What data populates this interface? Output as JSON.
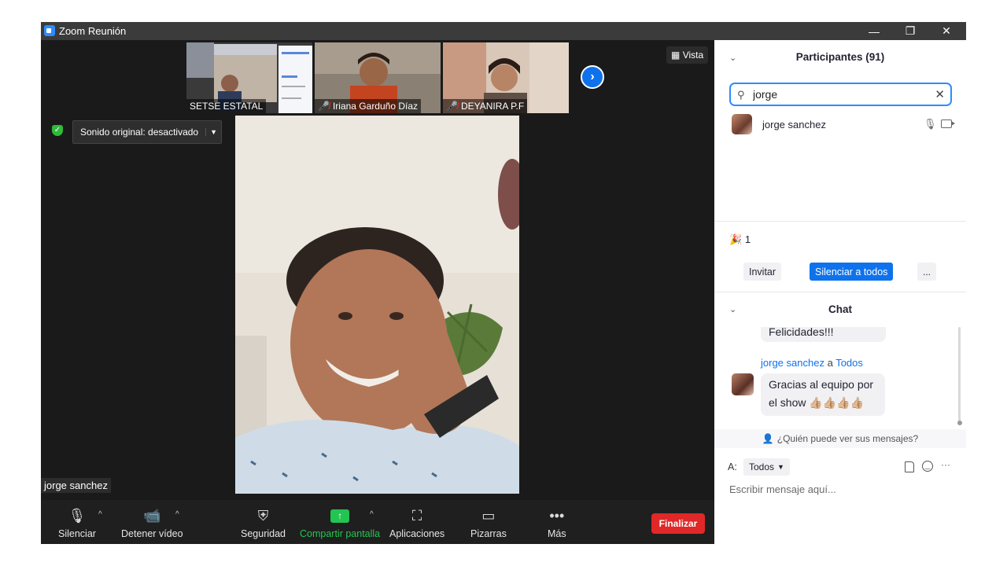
{
  "window": {
    "title": "Zoom Reunión",
    "controls": {
      "minimize": "—",
      "restore": "❐",
      "close": "✕"
    }
  },
  "video": {
    "thumbnails": [
      {
        "name": "SETSE ESTATAL",
        "muted": false
      },
      {
        "name": "Iriana Garduño Díaz",
        "muted": true
      },
      {
        "name": "DEYANIRA P.F",
        "muted": true
      }
    ],
    "next_icon": "›",
    "view_label": "Vista",
    "original_sound_label": "Sonido original: desactivado",
    "speaker_name": "jorge sanchez"
  },
  "toolbar": {
    "mute": "Silenciar",
    "stop_video": "Detener vídeo",
    "security": "Seguridad",
    "share_screen": "Compartir pantalla",
    "apps": "Aplicaciones",
    "whiteboards": "Pizarras",
    "more": "Más",
    "end": "Finalizar",
    "chevron": "^",
    "share_arrow": "↑"
  },
  "participants": {
    "title": "Participantes (91)",
    "search_value": "jorge",
    "results": [
      {
        "name": "jorge sanchez"
      }
    ],
    "reaction_count": "1",
    "invite": "Invitar",
    "mute_all": "Silenciar a todos",
    "more": "..."
  },
  "chat": {
    "title": "Chat",
    "previous_message": "Felicidades!!!",
    "message": {
      "sender": "jorge sanchez",
      "connector": "a",
      "recipient": "Todos",
      "text": "Gracias al equipo por el show 👍🏼👍🏼👍🏼👍🏼"
    },
    "privacy_text": "¿Quién puede ver sus mensajes?",
    "to_label": "A:",
    "to_value": "Todos",
    "more": "···",
    "input_placeholder": "Escribir mensaje aquí..."
  },
  "colors": {
    "accent": "#0e72ed",
    "share_green": "#23c552",
    "end_red": "#e02828"
  }
}
